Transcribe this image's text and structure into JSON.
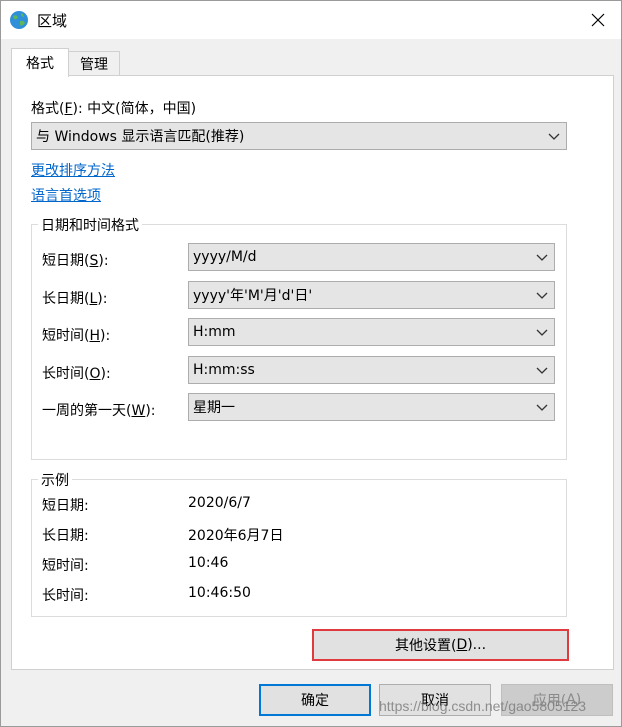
{
  "title": "区域",
  "tabs": [
    {
      "label": "格式"
    },
    {
      "label": "管理"
    }
  ],
  "format": {
    "label_prefix": "格式(",
    "label_key": "F",
    "label_suffix": "): 中文(简体，中国)",
    "select_value": "与 Windows 显示语言匹配(推荐)"
  },
  "links": {
    "sort": "更改排序方法",
    "lang": "语言首选项"
  },
  "datetime": {
    "group_title": "日期和时间格式",
    "rows": [
      {
        "prefix": "短日期(",
        "key": "S",
        "suffix": "):",
        "value": "yyyy/M/d"
      },
      {
        "prefix": "长日期(",
        "key": "L",
        "suffix": "):",
        "value": "yyyy'年'M'月'd'日'"
      },
      {
        "prefix": "短时间(",
        "key": "H",
        "suffix": "):",
        "value": "H:mm"
      },
      {
        "prefix": "长时间(",
        "key": "O",
        "suffix": "):",
        "value": "H:mm:ss"
      },
      {
        "prefix": "一周的第一天(",
        "key": "W",
        "suffix": "):",
        "value": "星期一"
      }
    ]
  },
  "example": {
    "group_title": "示例",
    "rows": [
      {
        "label": "短日期:",
        "value": "2020/6/7"
      },
      {
        "label": "长日期:",
        "value": "2020年6月7日"
      },
      {
        "label": "短时间:",
        "value": "10:46"
      },
      {
        "label": "长时间:",
        "value": "10:46:50"
      }
    ]
  },
  "other_settings": {
    "prefix": "其他设置(",
    "key": "D",
    "suffix": ")..."
  },
  "buttons": {
    "ok": "确定",
    "cancel": "取消",
    "apply_prefix": "应用(",
    "apply_key": "A",
    "apply_suffix": ")"
  },
  "watermark": "https://blog.csdn.net/gao5805123",
  "colors": {
    "accent": "#0078d7",
    "highlight": "#e0393e",
    "link": "#0066cc"
  }
}
